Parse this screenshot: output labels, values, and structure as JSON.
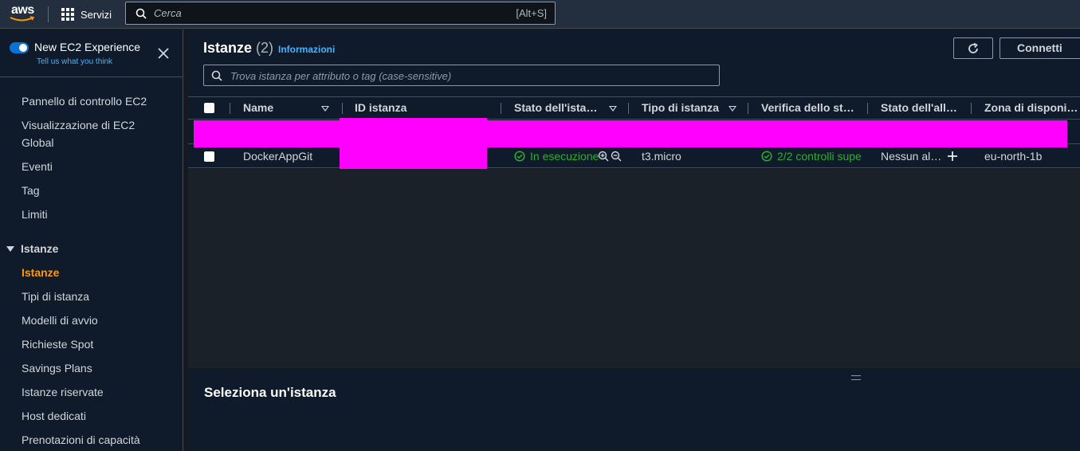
{
  "topnav": {
    "logo": "aws",
    "services_label": "Servizi",
    "search_placeholder": "Cerca",
    "search_shortcut": "[Alt+S]"
  },
  "sidebar": {
    "experience_title": "New EC2 Experience",
    "experience_sub": "Tell us what you think",
    "items": [
      {
        "label": "Pannello di controllo EC2"
      },
      {
        "label": "Visualizzazione di EC2"
      },
      {
        "label": "Global"
      },
      {
        "label": "Eventi"
      },
      {
        "label": "Tag"
      },
      {
        "label": "Limiti"
      }
    ],
    "section": "Istanze",
    "section_items": [
      {
        "label": "Istanze",
        "active": true
      },
      {
        "label": "Tipi di istanza"
      },
      {
        "label": "Modelli di avvio"
      },
      {
        "label": "Richieste Spot"
      },
      {
        "label": "Savings Plans"
      },
      {
        "label": "Istanze riservate"
      },
      {
        "label": "Host dedicati"
      },
      {
        "label": "Prenotazioni di capacità"
      }
    ]
  },
  "main": {
    "title": "Istanze",
    "count": "(2)",
    "info_link": "Informazioni",
    "connect_label": "Connetti",
    "filter_placeholder": "Trova istanza per attributo o tag (case-sensitive)",
    "columns": [
      "Name",
      "ID istanza",
      "Stato dell'ista…",
      "Tipo di istanza",
      "Verifica dello st…",
      "Stato dell'all…",
      "Zona di disponi…"
    ],
    "rows": [
      {
        "name": "DockerAppGit",
        "state": "In esecuzione",
        "type": "t3.micro",
        "checks": "2/2 controlli supe",
        "alarm": "Nessun al…",
        "zone": "eu-north-1b"
      }
    ],
    "detail_title": "Seleziona un'istanza"
  },
  "colors": {
    "accent": "#ff9900",
    "link": "#42b4ff",
    "success": "#29ad32",
    "redaction": "#ff00ff"
  }
}
